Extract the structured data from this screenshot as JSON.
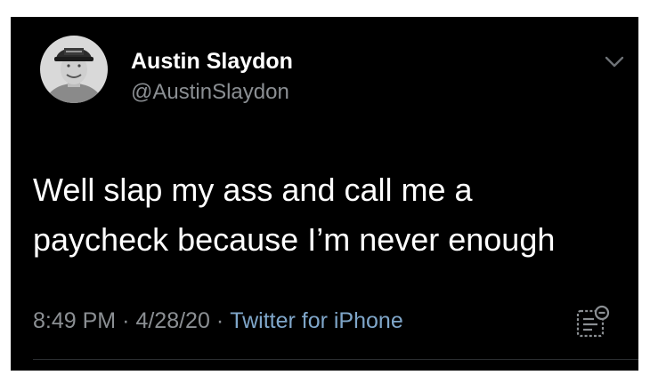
{
  "tweet": {
    "display_name": "Austin Slaydon",
    "handle": "@AustinSlaydon",
    "text": "Well slap my ass and call me a\npaycheck because I’m never enough",
    "time": "8:49 PM",
    "date": "4/28/20",
    "source": "Twitter for iPhone",
    "separator": "·"
  },
  "icons": {
    "menu": "chevron-down-icon",
    "analytics": "analytics-icon"
  },
  "colors": {
    "background": "#000000",
    "text": "#ffffff",
    "secondary_text": "#8b8f93",
    "link": "#7fa6c9"
  }
}
